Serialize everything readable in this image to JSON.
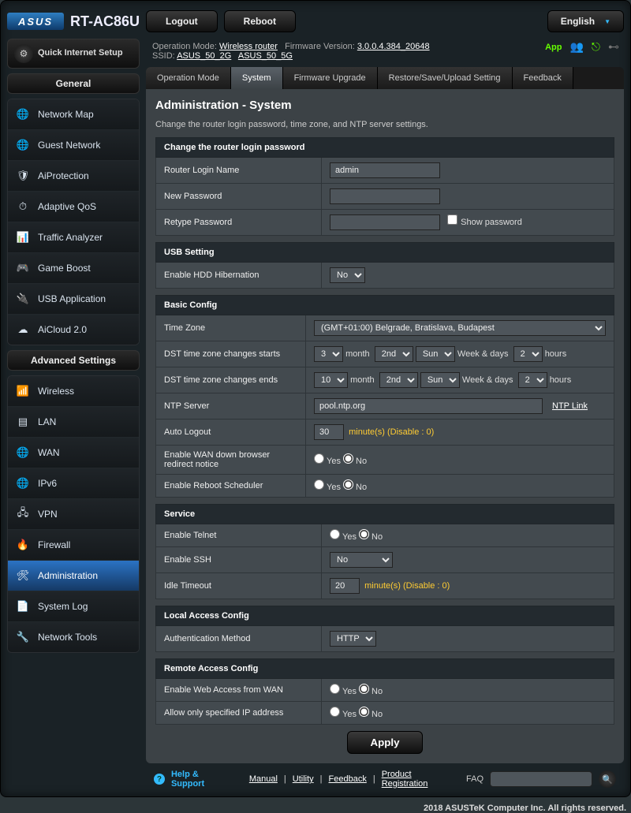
{
  "brand": "ASUS",
  "model": "RT-AC86U",
  "topbar": {
    "logout": "Logout",
    "reboot": "Reboot",
    "language": "English"
  },
  "status": {
    "opmode_label": "Operation Mode:",
    "opmode_value": "Wireless router",
    "fw_label": "Firmware Version:",
    "fw_value": "3.0.0.4.384_20648",
    "ssid_label": "SSID:",
    "ssid_2g": "ASUS_50_2G",
    "ssid_5g": "ASUS_50_5G",
    "app": "App"
  },
  "tabs": [
    "Operation Mode",
    "System",
    "Firmware Upgrade",
    "Restore/Save/Upload Setting",
    "Feedback"
  ],
  "page_title": "Administration - System",
  "desc": "Change the router login password, time zone, and NTP server settings.",
  "sidebar": {
    "qis": "Quick Internet Setup",
    "general_header": "General",
    "general": [
      "Network Map",
      "Guest Network",
      "AiProtection",
      "Adaptive QoS",
      "Traffic Analyzer",
      "Game Boost",
      "USB Application",
      "AiCloud 2.0"
    ],
    "adv_header": "Advanced Settings",
    "advanced": [
      "Wireless",
      "LAN",
      "WAN",
      "IPv6",
      "VPN",
      "Firewall",
      "Administration",
      "System Log",
      "Network Tools"
    ]
  },
  "sections": {
    "login": {
      "title": "Change the router login password",
      "name_label": "Router Login Name",
      "name_value": "admin",
      "new_pw": "New Password",
      "retype": "Retype Password",
      "showpw": "Show password"
    },
    "usb": {
      "title": "USB Setting",
      "hdd_label": "Enable HDD Hibernation",
      "hdd_value": "No"
    },
    "basic": {
      "title": "Basic Config",
      "tz_label": "Time Zone",
      "tz_value": "(GMT+01:00) Belgrade, Bratislava, Budapest",
      "dst_start": "DST time zone changes starts",
      "dst_end": "DST time zone changes ends",
      "month": "month",
      "weekdays": "Week & days",
      "hours": "hours",
      "start_m": "3",
      "start_w": "2nd",
      "start_d": "Sun",
      "start_h": "2",
      "end_m": "10",
      "end_w": "2nd",
      "end_d": "Sun",
      "end_h": "2",
      "ntp_label": "NTP Server",
      "ntp_value": "pool.ntp.org",
      "ntp_link": "NTP Link",
      "autologout_label": "Auto Logout",
      "autologout_value": "30",
      "autologout_hint": "minute(s) (Disable : 0)",
      "wan_redirect": "Enable WAN down browser redirect notice",
      "reboot_sched": "Enable Reboot Scheduler",
      "yes": "Yes",
      "no": "No"
    },
    "service": {
      "title": "Service",
      "telnet": "Enable Telnet",
      "ssh": "Enable SSH",
      "ssh_value": "No",
      "idle": "Idle Timeout",
      "idle_value": "20",
      "idle_hint": "minute(s) (Disable : 0)"
    },
    "local": {
      "title": "Local Access Config",
      "auth": "Authentication Method",
      "auth_value": "HTTP"
    },
    "remote": {
      "title": "Remote Access Config",
      "web": "Enable Web Access from WAN",
      "ip": "Allow only specified IP address"
    }
  },
  "apply": "Apply",
  "footer": {
    "help": "Help & Support",
    "manual": "Manual",
    "utility": "Utility",
    "feedback": "Feedback",
    "register": "Product Registration",
    "faq": "FAQ"
  },
  "copyright": "2018 ASUSTeK Computer Inc. All rights reserved."
}
